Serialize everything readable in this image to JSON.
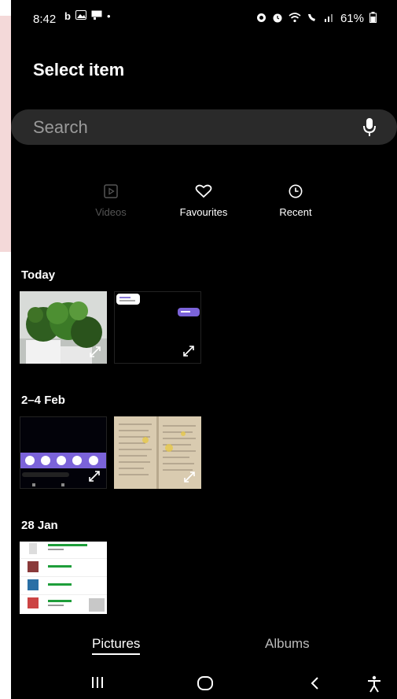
{
  "status": {
    "time": "8:42",
    "battery": "61%"
  },
  "header": {
    "title": "Select item"
  },
  "search": {
    "placeholder": "Search"
  },
  "filters": [
    {
      "label": "Videos",
      "icon": "video-icon",
      "enabled": false
    },
    {
      "label": "Favourites",
      "icon": "heart-icon",
      "enabled": true
    },
    {
      "label": "Recent",
      "icon": "clock-icon",
      "enabled": true
    }
  ],
  "sections": [
    {
      "title": "Today"
    },
    {
      "title": "2–4 Feb"
    },
    {
      "title": "28 Jan"
    }
  ],
  "bottom_tabs": {
    "pictures": "Pictures",
    "albums": "Albums"
  },
  "colors": {
    "background": "#000000",
    "search_bg": "#2a2a2a",
    "accent_purple": "#7b63d9",
    "delivery_green": "#1e9e3a"
  }
}
